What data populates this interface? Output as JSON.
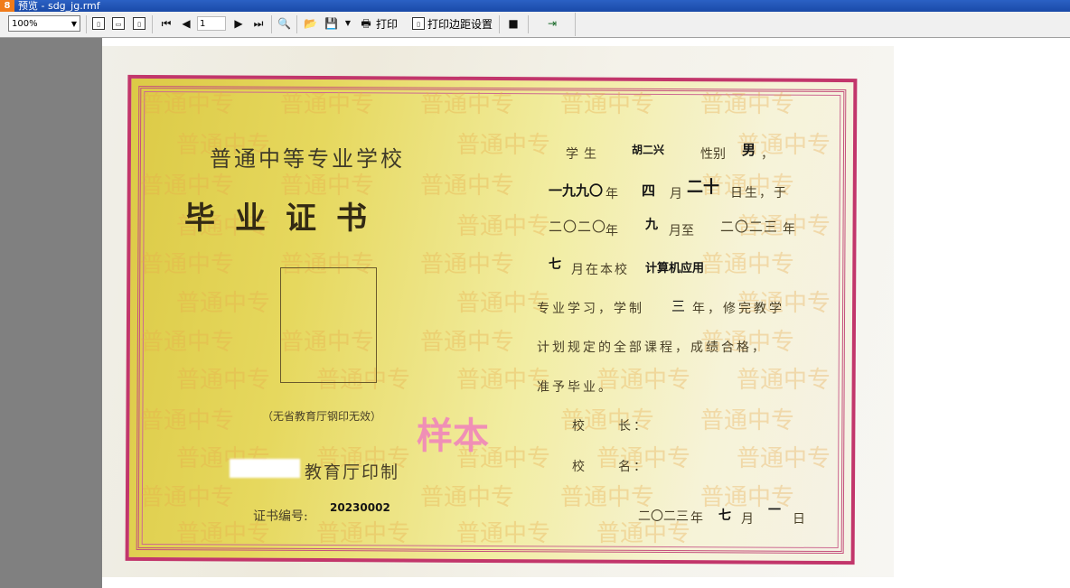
{
  "window": {
    "title": "预览 - sdg_jg.rmf"
  },
  "toolbar": {
    "zoom": "100%",
    "page_number": "1",
    "print_label": "打印",
    "print_margin_label": "打印边距设置"
  },
  "certificate": {
    "school_type": "普通中等专业学校",
    "title": "毕业证书",
    "photo_note": "（无省教育厅钢印无效）",
    "issuer_suffix": "教育厅印制",
    "cert_no_label": "证书编号:",
    "cert_no": "20230002",
    "sample_mark": "样本",
    "watermark": "普通中专",
    "student_label": "学生",
    "student_name": "胡二兴",
    "gender_label": "性别",
    "gender": "男",
    "comma": "，",
    "birth_year": "一九九〇",
    "year_char": "年",
    "birth_month": "四",
    "month_char": "月",
    "birth_day": "二十",
    "born_text": "日生，于",
    "start_year": "二〇二〇",
    "start_month": "九",
    "month_to": "月至",
    "end_year": "二〇二三",
    "end_month": "七",
    "at_school": "月在本校",
    "major": "计算机应用",
    "study_text_1": "专业学习，学制",
    "duration": "三",
    "study_text_2": "年，修完教学",
    "line_plan": "计划规定的全部课程，成绩合格，",
    "line_grad": "准予毕业。",
    "principal_label": "校　　长：",
    "school_label": "校　　名：",
    "issue_year": "二〇二三",
    "issue_year_char": "年",
    "issue_month": "七",
    "issue_month_char": "月",
    "issue_day": "一",
    "issue_day_char": "日"
  }
}
